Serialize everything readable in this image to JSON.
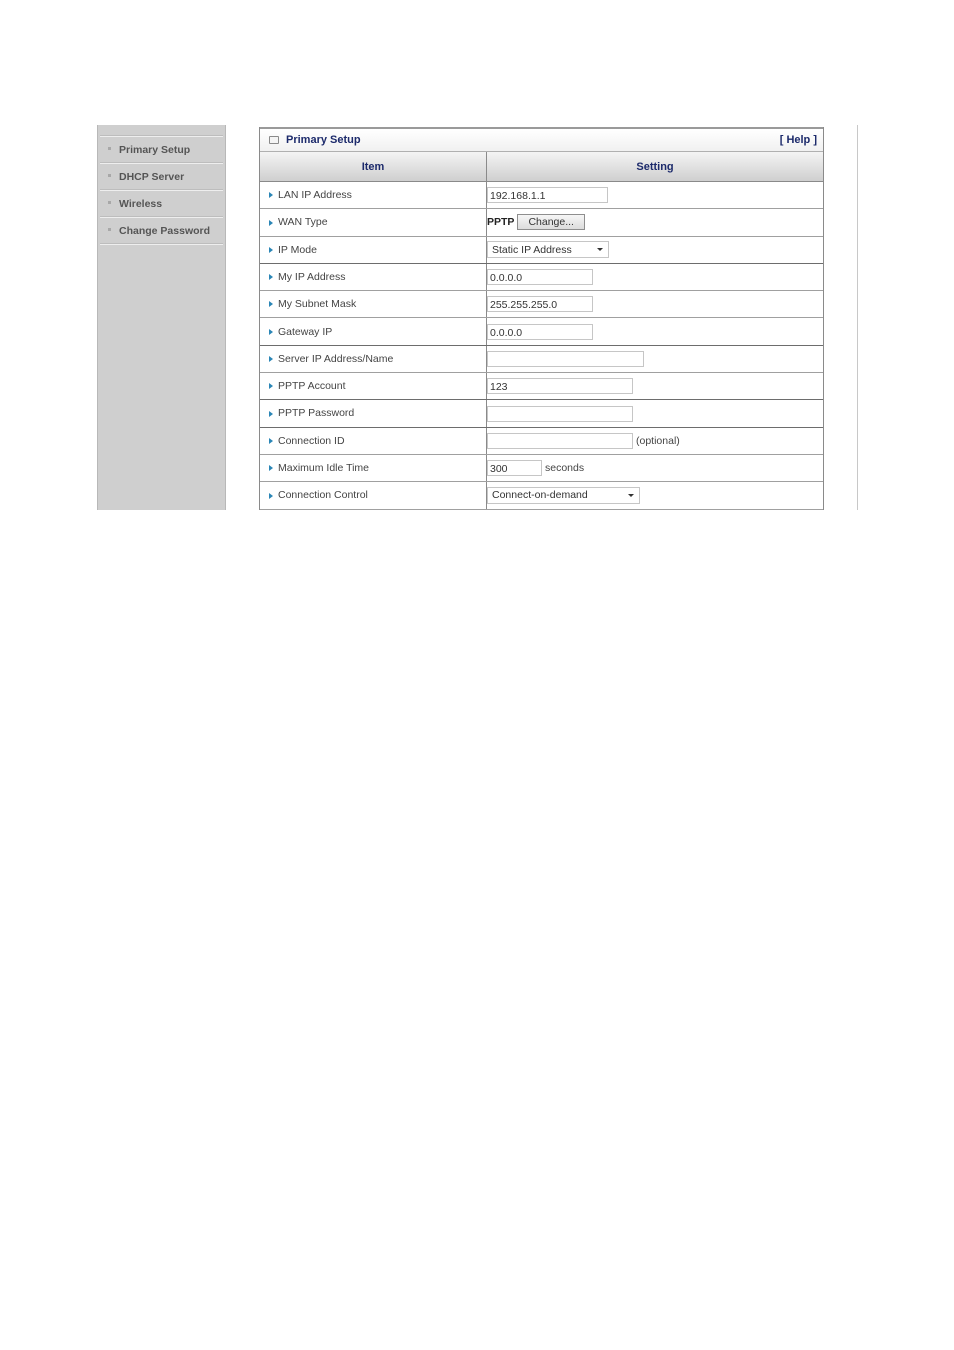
{
  "sidebar": {
    "items": [
      {
        "label": "Primary Setup"
      },
      {
        "label": "DHCP Server"
      },
      {
        "label": "Wireless"
      },
      {
        "label": "Change Password"
      }
    ]
  },
  "panel": {
    "title": "Primary Setup",
    "help": "[ Help ]",
    "columns": {
      "item": "Item",
      "setting": "Setting"
    }
  },
  "rows": {
    "lan_ip": {
      "label": "LAN IP Address",
      "value": "192.168.1.1"
    },
    "wan_type": {
      "label": "WAN Type",
      "value": "PPTP",
      "button": "Change..."
    },
    "ip_mode": {
      "label": "IP Mode",
      "selected": "Static IP Address"
    },
    "my_ip": {
      "label": "My IP Address",
      "value": "0.0.0.0"
    },
    "subnet": {
      "label": "My Subnet Mask",
      "value": "255.255.255.0"
    },
    "gateway": {
      "label": "Gateway IP",
      "value": "0.0.0.0"
    },
    "server": {
      "label": "Server IP Address/Name",
      "value": ""
    },
    "account": {
      "label": "PPTP Account",
      "value": "123"
    },
    "password": {
      "label": "PPTP Password",
      "value": ""
    },
    "conn_id": {
      "label": "Connection ID",
      "value": "",
      "suffix": "(optional)"
    },
    "idle": {
      "label": "Maximum Idle Time",
      "value": "300",
      "suffix": "seconds"
    },
    "control": {
      "label": "Connection Control",
      "selected": "Connect-on-demand"
    }
  },
  "colors": {
    "title_text": "#1c2a6b",
    "arrow": "#2b86b6",
    "sidebar_bg": "#cfcfcf"
  }
}
